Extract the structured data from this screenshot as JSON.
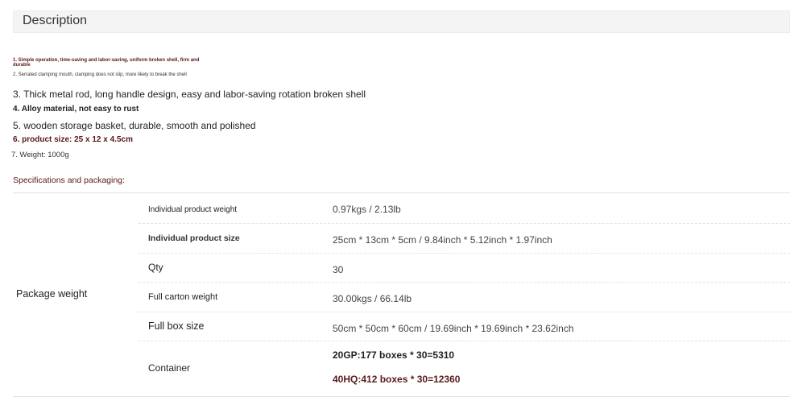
{
  "description": {
    "title": "Description",
    "features": [
      "1. Simple operation, time-saving and labor-saving, uniform broken shell, firm and durable",
      "2. Serrated clamping mouth, clamping does not slip, more likely to break the shell",
      "3. Thick metal rod, long handle design, easy and labor-saving rotation broken shell",
      "4. Alloy material, not easy to rust",
      "5. wooden storage basket, durable, smooth and polished",
      "6. product size: 25 x 12 x 4.5cm",
      "7. Weight: 1000g"
    ]
  },
  "specifications": {
    "title": "Specifications and packaging:",
    "group_label": "Package weight",
    "rows": [
      {
        "label": "Individual product weight",
        "value": "0.97kgs / 2.13lb"
      },
      {
        "label": "Individual product size",
        "value": "25cm * 13cm * 5cm / 9.84inch * 5.12inch * 1.97inch"
      },
      {
        "label": "Qty",
        "value": "30"
      },
      {
        "label": "Full carton weight",
        "value": "30.00kgs / 66.14lb"
      },
      {
        "label": "Full box size",
        "value": "50cm * 50cm * 60cm / 19.69inch * 19.69inch * 23.62inch"
      },
      {
        "label": "Container",
        "value_1": "20GP:177 boxes * 30=5310",
        "value_2": "40HQ:412 boxes * 30=12360"
      }
    ]
  }
}
